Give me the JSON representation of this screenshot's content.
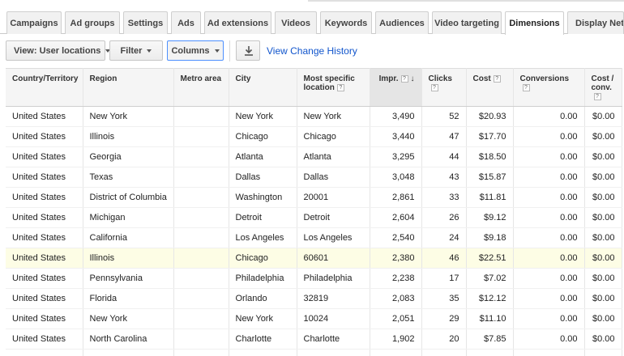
{
  "tabs": [
    {
      "label": "Campaigns"
    },
    {
      "label": "Ad groups"
    },
    {
      "label": "Settings"
    },
    {
      "label": "Ads"
    },
    {
      "label": "Ad extensions"
    },
    {
      "label": "Videos"
    },
    {
      "label": "Keywords"
    },
    {
      "label": "Audiences"
    },
    {
      "label": "Video targeting"
    },
    {
      "label": "Dimensions"
    },
    {
      "label": "Display Netwo"
    }
  ],
  "active_tab": "Dimensions",
  "toolbar": {
    "view_label": "View: User locations",
    "filter_label": "Filter",
    "columns_label": "Columns",
    "download_icon": "download-icon",
    "history_link": "View Change History"
  },
  "table": {
    "headers": {
      "country": "Country/Territory",
      "region": "Region",
      "metro": "Metro area",
      "city": "City",
      "specific": "Most specific location",
      "impr": "Impr.",
      "clicks": "Clicks",
      "cost": "Cost",
      "conversions": "Conversions",
      "cost_conv": "Cost / conv."
    },
    "help_glyph": "?",
    "sort_glyph": "↓",
    "rows": [
      {
        "country": "United States",
        "region": "New York",
        "metro": "",
        "city": "New York",
        "specific": "New York",
        "impr": "3,490",
        "clicks": "52",
        "cost": "$20.93",
        "conversions": "0.00",
        "cost_conv": "$0.00"
      },
      {
        "country": "United States",
        "region": "Illinois",
        "metro": "",
        "city": "Chicago",
        "specific": "Chicago",
        "impr": "3,440",
        "clicks": "47",
        "cost": "$17.70",
        "conversions": "0.00",
        "cost_conv": "$0.00"
      },
      {
        "country": "United States",
        "region": "Georgia",
        "metro": "",
        "city": "Atlanta",
        "specific": "Atlanta",
        "impr": "3,295",
        "clicks": "44",
        "cost": "$18.50",
        "conversions": "0.00",
        "cost_conv": "$0.00"
      },
      {
        "country": "United States",
        "region": "Texas",
        "metro": "",
        "city": "Dallas",
        "specific": "Dallas",
        "impr": "3,048",
        "clicks": "43",
        "cost": "$15.87",
        "conversions": "0.00",
        "cost_conv": "$0.00"
      },
      {
        "country": "United States",
        "region": "District of Columbia",
        "metro": "",
        "city": "Washington",
        "specific": "20001",
        "impr": "2,861",
        "clicks": "33",
        "cost": "$11.81",
        "conversions": "0.00",
        "cost_conv": "$0.00"
      },
      {
        "country": "United States",
        "region": "Michigan",
        "metro": "",
        "city": "Detroit",
        "specific": "Detroit",
        "impr": "2,604",
        "clicks": "26",
        "cost": "$9.12",
        "conversions": "0.00",
        "cost_conv": "$0.00"
      },
      {
        "country": "United States",
        "region": "California",
        "metro": "",
        "city": "Los Angeles",
        "specific": "Los Angeles",
        "impr": "2,540",
        "clicks": "24",
        "cost": "$9.18",
        "conversions": "0.00",
        "cost_conv": "$0.00"
      },
      {
        "country": "United States",
        "region": "Illinois",
        "metro": "",
        "city": "Chicago",
        "specific": "60601",
        "impr": "2,380",
        "clicks": "46",
        "cost": "$22.51",
        "conversions": "0.00",
        "cost_conv": "$0.00"
      },
      {
        "country": "United States",
        "region": "Pennsylvania",
        "metro": "",
        "city": "Philadelphia",
        "specific": "Philadelphia",
        "impr": "2,238",
        "clicks": "17",
        "cost": "$7.02",
        "conversions": "0.00",
        "cost_conv": "$0.00"
      },
      {
        "country": "United States",
        "region": "Florida",
        "metro": "",
        "city": "Orlando",
        "specific": "32819",
        "impr": "2,083",
        "clicks": "35",
        "cost": "$12.12",
        "conversions": "0.00",
        "cost_conv": "$0.00"
      },
      {
        "country": "United States",
        "region": "New York",
        "metro": "",
        "city": "New York",
        "specific": "10024",
        "impr": "2,051",
        "clicks": "29",
        "cost": "$11.10",
        "conversions": "0.00",
        "cost_conv": "$0.00"
      },
      {
        "country": "United States",
        "region": "North Carolina",
        "metro": "",
        "city": "Charlotte",
        "specific": "Charlotte",
        "impr": "1,902",
        "clicks": "20",
        "cost": "$7.85",
        "conversions": "0.00",
        "cost_conv": "$0.00"
      }
    ]
  }
}
